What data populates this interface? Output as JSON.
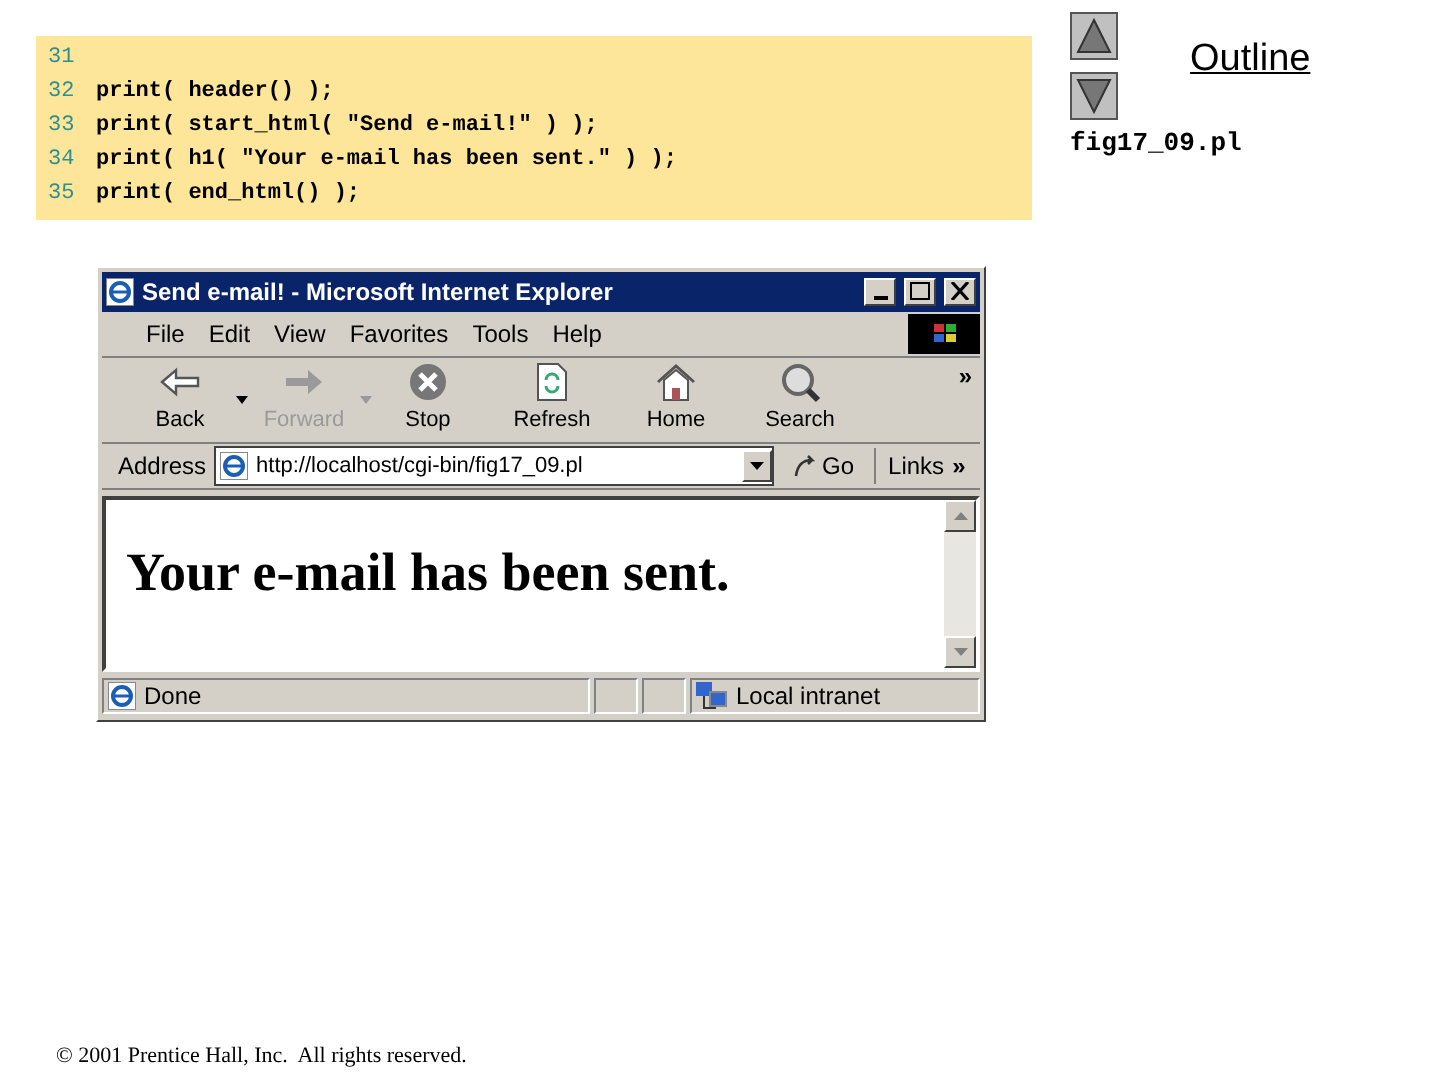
{
  "code": {
    "lines": [
      {
        "number": "31"
      },
      {
        "number": "32",
        "text": "print( header() );"
      },
      {
        "number": "33",
        "text": "print( start_html( \"Send e-mail!\" ) );"
      },
      {
        "number": "34",
        "text": "print( h1( \"Your e-mail has been sent.\" ) );"
      },
      {
        "number": "35",
        "text": "print( end_html() );"
      }
    ]
  },
  "browser": {
    "title": "Send e-mail! - Microsoft Internet Explorer",
    "menu": [
      "File",
      "Edit",
      "View",
      "Favorites",
      "Tools",
      "Help"
    ],
    "toolbar": [
      {
        "kind": "back",
        "label": "Back",
        "disabled": false,
        "dropdown": true
      },
      {
        "kind": "forward",
        "label": "Forward",
        "disabled": true,
        "dropdown": true
      },
      {
        "kind": "stop",
        "label": "Stop",
        "disabled": false,
        "dropdown": false
      },
      {
        "kind": "refresh",
        "label": "Refresh",
        "disabled": false,
        "dropdown": false
      },
      {
        "kind": "home",
        "label": "Home",
        "disabled": false,
        "dropdown": false
      },
      {
        "kind": "search",
        "label": "Search",
        "disabled": false,
        "dropdown": false
      }
    ],
    "toolbar_more": "»",
    "address_label": "Address",
    "url": "http://localhost/cgi-bin/fig17_09.pl",
    "go": "Go",
    "links": "Links",
    "links_more": "»",
    "heading": "Your e-mail has been sent.",
    "status": "Done",
    "zone": "Local intranet"
  },
  "outline": {
    "title": "Outline",
    "filename": "fig17_09.pl"
  },
  "footer": "© 2001 Prentice Hall, Inc.  All rights reserved."
}
